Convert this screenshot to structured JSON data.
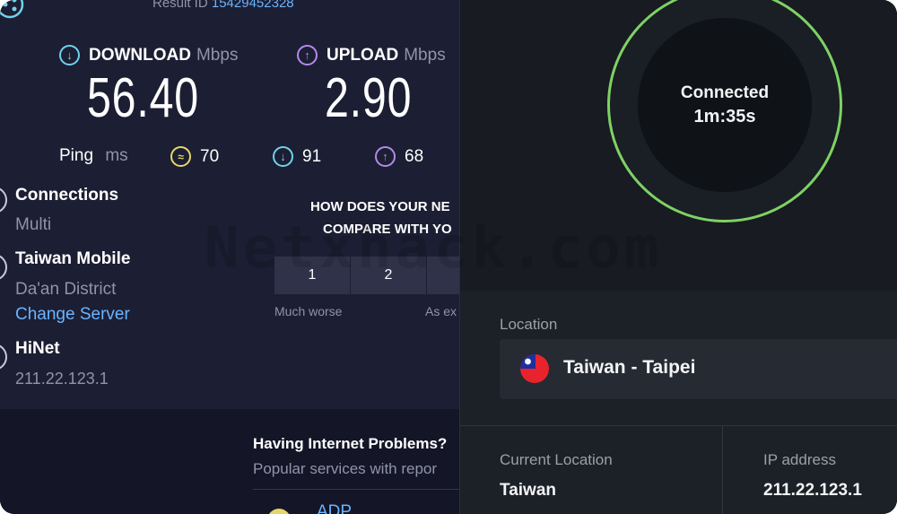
{
  "speedtest": {
    "result_label": "Result ID",
    "result_id": "15429452328",
    "download": {
      "label": "DOWNLOAD",
      "unit": "Mbps",
      "value": "56.40"
    },
    "upload": {
      "label": "UPLOAD",
      "unit": "Mbps",
      "value": "2.90"
    },
    "ping": {
      "label": "Ping",
      "unit": "ms",
      "idle": "70",
      "down": "91",
      "up": "68"
    },
    "connections": {
      "label": "Connections",
      "value": "Multi"
    },
    "server": {
      "name": "Taiwan Mobile",
      "location": "Da'an District",
      "change_label": "Change Server"
    },
    "isp": {
      "name": "HiNet",
      "ip": "211.22.123.1"
    },
    "survey": {
      "line1": "HOW DOES YOUR NE",
      "line2": "COMPARE WITH YO",
      "options": [
        "1",
        "2"
      ],
      "left_label": "Much worse",
      "mid_label": "As ex"
    },
    "problems": {
      "title": "Having Internet Problems?",
      "subtitle": "Popular services with repor",
      "item": "ADP"
    }
  },
  "watermark": "Netxhack.com",
  "vpn": {
    "status": "Connected",
    "timer": "1m:35s",
    "location_label": "Location",
    "location_value": "Taiwan - Taipei",
    "current_location_label": "Current Location",
    "current_location_value": "Taiwan",
    "ip_label": "IP address",
    "ip_value": "211.22.123.1"
  },
  "colors": {
    "accent_link": "#6ab4ff",
    "download": "#6fd2ea",
    "upload": "#b489e8",
    "ping_idle": "#e3d768",
    "connected_ring": "#7ed263"
  }
}
